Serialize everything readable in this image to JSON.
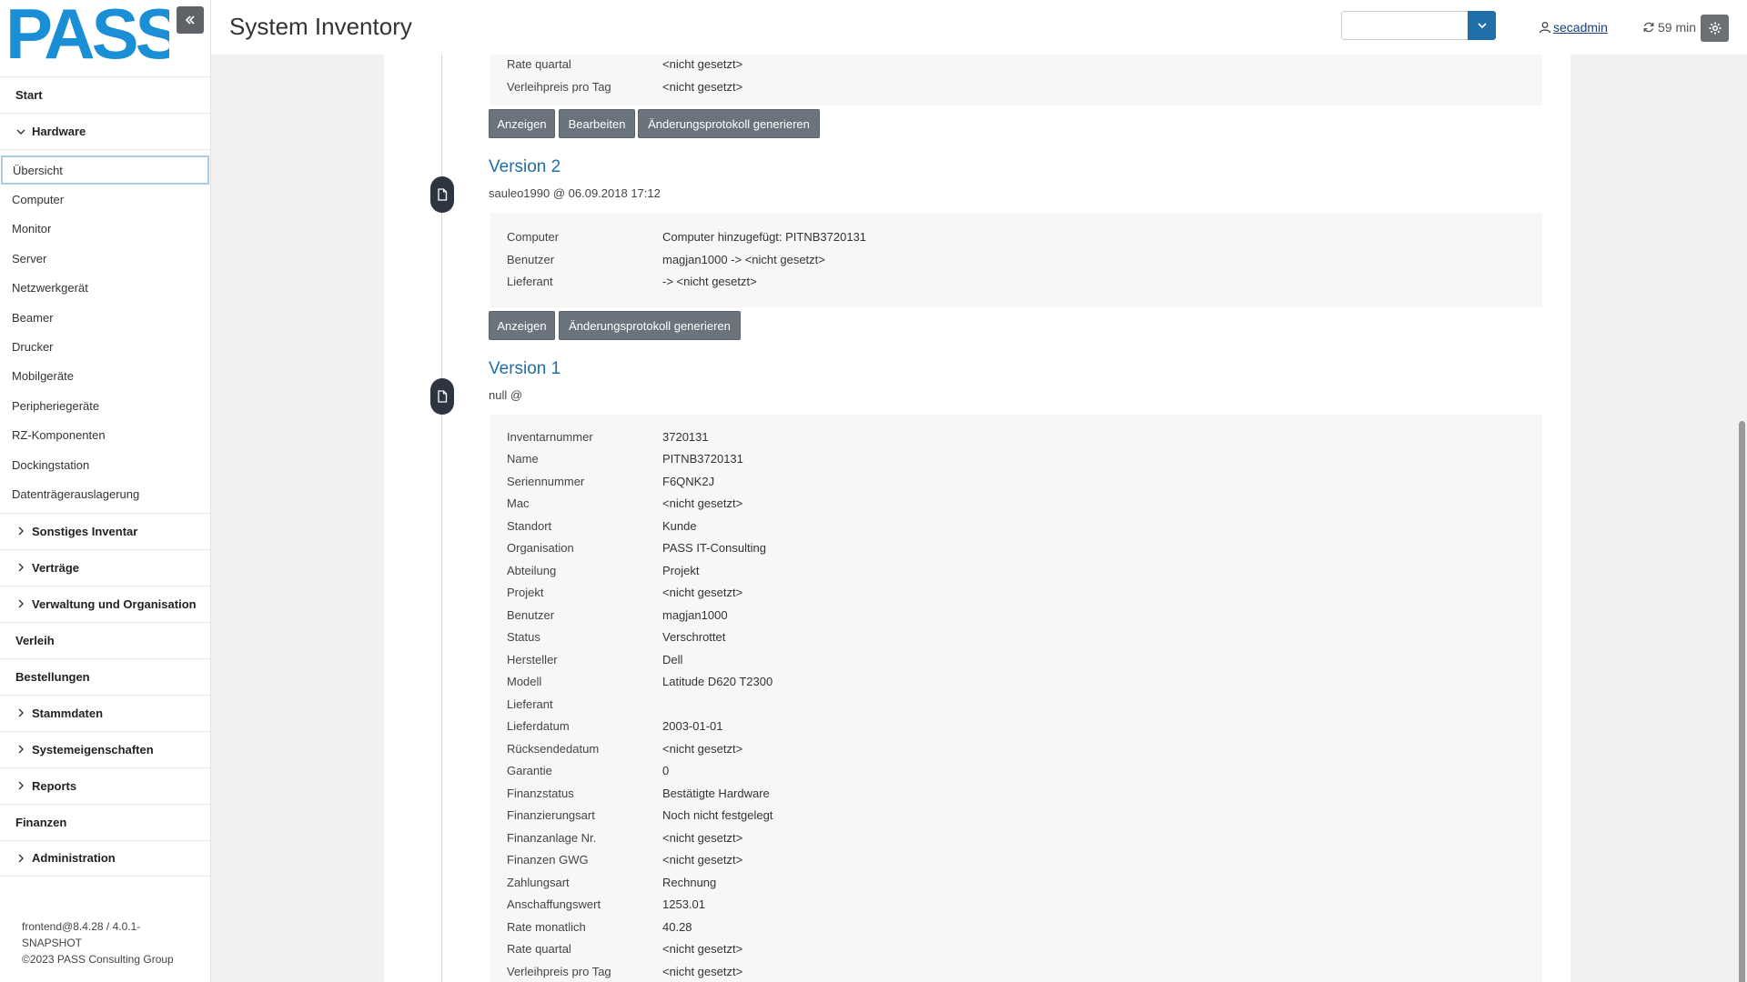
{
  "app": {
    "logo_text": "PASS",
    "page_title": "System Inventory",
    "user": "secadmin",
    "timer": "59 min"
  },
  "sidebar": {
    "items_top": [
      {
        "label": "Start"
      },
      {
        "label": "Hardware"
      }
    ],
    "hardware_sub": [
      {
        "label": "Übersicht"
      },
      {
        "label": "Computer"
      },
      {
        "label": "Monitor"
      },
      {
        "label": "Server"
      },
      {
        "label": "Netzwerkgerät"
      },
      {
        "label": "Beamer"
      },
      {
        "label": "Drucker"
      },
      {
        "label": "Mobilgeräte"
      },
      {
        "label": "Peripheriegeräte"
      },
      {
        "label": "RZ-Komponenten"
      },
      {
        "label": "Dockingstation"
      },
      {
        "label": "Datenträgerauslagerung"
      }
    ],
    "items_bottom": [
      {
        "label": "Sonstiges Inventar"
      },
      {
        "label": "Verträge"
      },
      {
        "label": "Verwaltung und Organisation"
      },
      {
        "label": "Verleih"
      },
      {
        "label": "Bestellungen"
      },
      {
        "label": "Stammdaten"
      },
      {
        "label": "Systemeigenschaften"
      },
      {
        "label": "Reports"
      },
      {
        "label": "Finanzen"
      },
      {
        "label": "Administration"
      }
    ],
    "footer_version": "frontend@8.4.28 / 4.0.1-SNAPSHOT",
    "footer_copyright": "©2023 PASS Consulting Group"
  },
  "version3_tail": {
    "rows": [
      {
        "label": "Rate quartal",
        "value": "<nicht gesetzt>"
      },
      {
        "label": "Verleihpreis pro Tag",
        "value": "<nicht gesetzt>"
      }
    ],
    "buttons": [
      "Anzeigen",
      "Bearbeiten",
      "Änderungsprotokoll generieren"
    ]
  },
  "version2": {
    "title": "Version 2",
    "meta": "sauleo1990 @ 06.09.2018 17:12",
    "rows": [
      {
        "label": "Computer",
        "value": "Computer hinzugefügt: PITNB3720131"
      },
      {
        "label": "Benutzer",
        "value": "magjan1000 -> <nicht gesetzt>"
      },
      {
        "label": "Lieferant",
        "value": "-> <nicht gesetzt>"
      }
    ],
    "buttons": [
      "Anzeigen",
      "Änderungsprotokoll generieren"
    ]
  },
  "version1": {
    "title": "Version 1",
    "meta": "null @",
    "rows": [
      {
        "label": "Inventarnummer",
        "value": "3720131"
      },
      {
        "label": "Name",
        "value": "PITNB3720131"
      },
      {
        "label": "Seriennummer",
        "value": "F6QNK2J"
      },
      {
        "label": "Mac",
        "value": "<nicht gesetzt>"
      },
      {
        "label": "Standort",
        "value": "Kunde"
      },
      {
        "label": "Organisation",
        "value": "PASS IT-Consulting"
      },
      {
        "label": "Abteilung",
        "value": "Projekt"
      },
      {
        "label": "Projekt",
        "value": "<nicht gesetzt>"
      },
      {
        "label": "Benutzer",
        "value": "magjan1000"
      },
      {
        "label": "Status",
        "value": "Verschrottet"
      },
      {
        "label": "Hersteller",
        "value": "Dell"
      },
      {
        "label": "Modell",
        "value": "Latitude D620 T2300"
      },
      {
        "label": "Lieferant",
        "value": ""
      },
      {
        "label": "Lieferdatum",
        "value": "2003-01-01"
      },
      {
        "label": "Rücksendedatum",
        "value": "<nicht gesetzt>"
      },
      {
        "label": "Garantie",
        "value": "0"
      },
      {
        "label": "Finanzstatus",
        "value": "Bestätigte Hardware"
      },
      {
        "label": "Finanzierungsart",
        "value": "Noch nicht festgelegt"
      },
      {
        "label": "Finanzanlage Nr.",
        "value": "<nicht gesetzt>"
      },
      {
        "label": "Finanzen GWG",
        "value": "<nicht gesetzt>"
      },
      {
        "label": "Zahlungsart",
        "value": "Rechnung"
      },
      {
        "label": "Anschaffungswert",
        "value": "1253.01"
      },
      {
        "label": "Rate monatlich",
        "value": "40.28"
      },
      {
        "label": "Rate quartal",
        "value": "<nicht gesetzt>"
      },
      {
        "label": "Verleihpreis pro Tag",
        "value": "<nicht gesetzt>"
      }
    ]
  },
  "colors": {
    "accent": "#1e6ea6",
    "brand": "#1a8fd6",
    "button": "#6b747c",
    "marker": "#2d3640"
  }
}
